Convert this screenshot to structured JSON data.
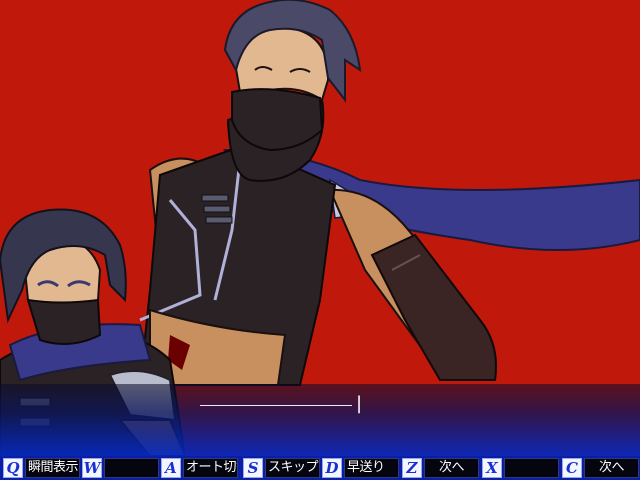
{
  "message": {
    "text": "|"
  },
  "hotkeys": [
    {
      "key": "Q",
      "label": "瞬間表示"
    },
    {
      "key": "W",
      "label": ""
    },
    {
      "key": "A",
      "label": "オート切替"
    },
    {
      "key": "S",
      "label": "スキップ"
    },
    {
      "key": "D",
      "label": "早送り"
    },
    {
      "key": "Z",
      "label": "次へ"
    },
    {
      "key": "X",
      "label": ""
    },
    {
      "key": "C",
      "label": "次へ"
    }
  ],
  "colors": {
    "background": "#c0190c",
    "message_window": "#0528be",
    "hotkey_bar": "#0a1fa8",
    "scarf": "#3a3a8c",
    "hair": "#4a4a68"
  }
}
